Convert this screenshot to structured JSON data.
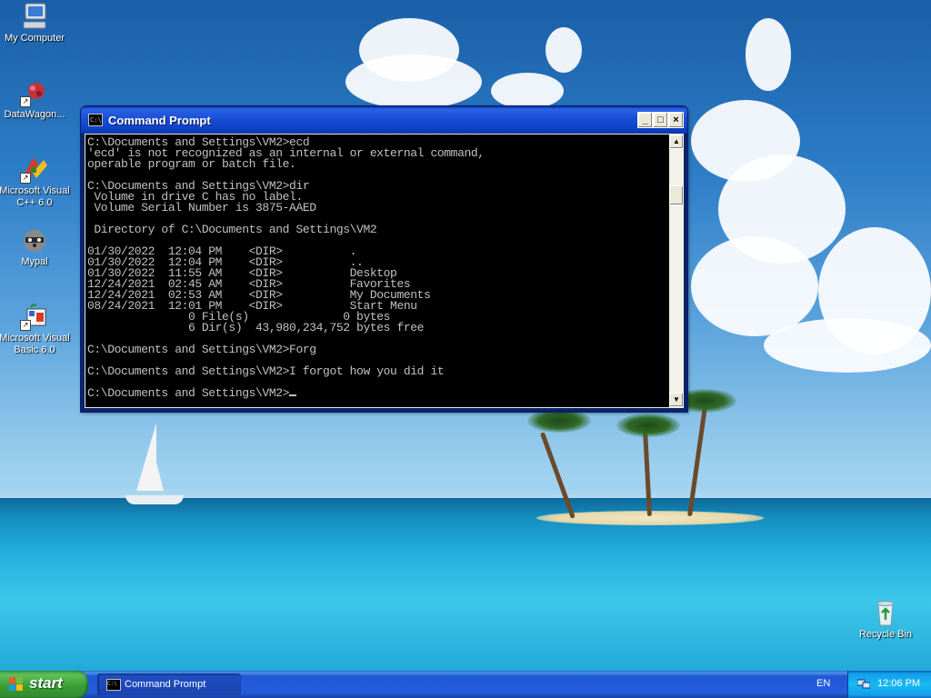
{
  "desktop": {
    "icons": [
      {
        "label": "My Computer",
        "icon": "my-computer-icon"
      },
      {
        "label": "DataWagon...",
        "icon": "datawagon-icon"
      },
      {
        "label": "Microsoft Visual C++ 6.0",
        "icon": "visual-cpp-icon"
      },
      {
        "label": "Mypal",
        "icon": "mypal-raccoon-icon"
      },
      {
        "label": "Microsoft Visual Basic 6.0",
        "icon": "visual-basic-icon"
      },
      {
        "label": "Recycle Bin",
        "icon": "recycle-bin-icon"
      }
    ]
  },
  "window": {
    "title": "Command Prompt",
    "icon_text": "C:\\",
    "buttons": {
      "minimize": "_",
      "maximize": "□",
      "close": "×"
    },
    "console_lines": [
      "C:\\Documents and Settings\\VM2>ecd",
      "'ecd' is not recognized as an internal or external command,",
      "operable program or batch file.",
      "",
      "C:\\Documents and Settings\\VM2>dir",
      " Volume in drive C has no label.",
      " Volume Serial Number is 3875-AAED",
      "",
      " Directory of C:\\Documents and Settings\\VM2",
      "",
      "01/30/2022  12:04 PM    <DIR>          .",
      "01/30/2022  12:04 PM    <DIR>          ..",
      "01/30/2022  11:55 AM    <DIR>          Desktop",
      "12/24/2021  02:45 AM    <DIR>          Favorites",
      "12/24/2021  02:53 AM    <DIR>          My Documents",
      "08/24/2021  12:01 PM    <DIR>          Start Menu",
      "               0 File(s)              0 bytes",
      "               6 Dir(s)  43,980,234,752 bytes free",
      "",
      "C:\\Documents and Settings\\VM2>Forg",
      "",
      "C:\\Documents and Settings\\VM2>I forgot how you did it",
      "",
      "C:\\Documents and Settings\\VM2>"
    ]
  },
  "taskbar": {
    "start_label": "start",
    "tasks": [
      {
        "label": "Command Prompt",
        "icon_text": "C:\\"
      }
    ],
    "language": "EN",
    "clock": "12:06 PM"
  },
  "colors": {
    "console_text": "#c0c0c0",
    "console_bg": "#000000",
    "titlebar": "#0f42c7",
    "taskbar": "#245edb",
    "start_button": "#3a9f37"
  }
}
